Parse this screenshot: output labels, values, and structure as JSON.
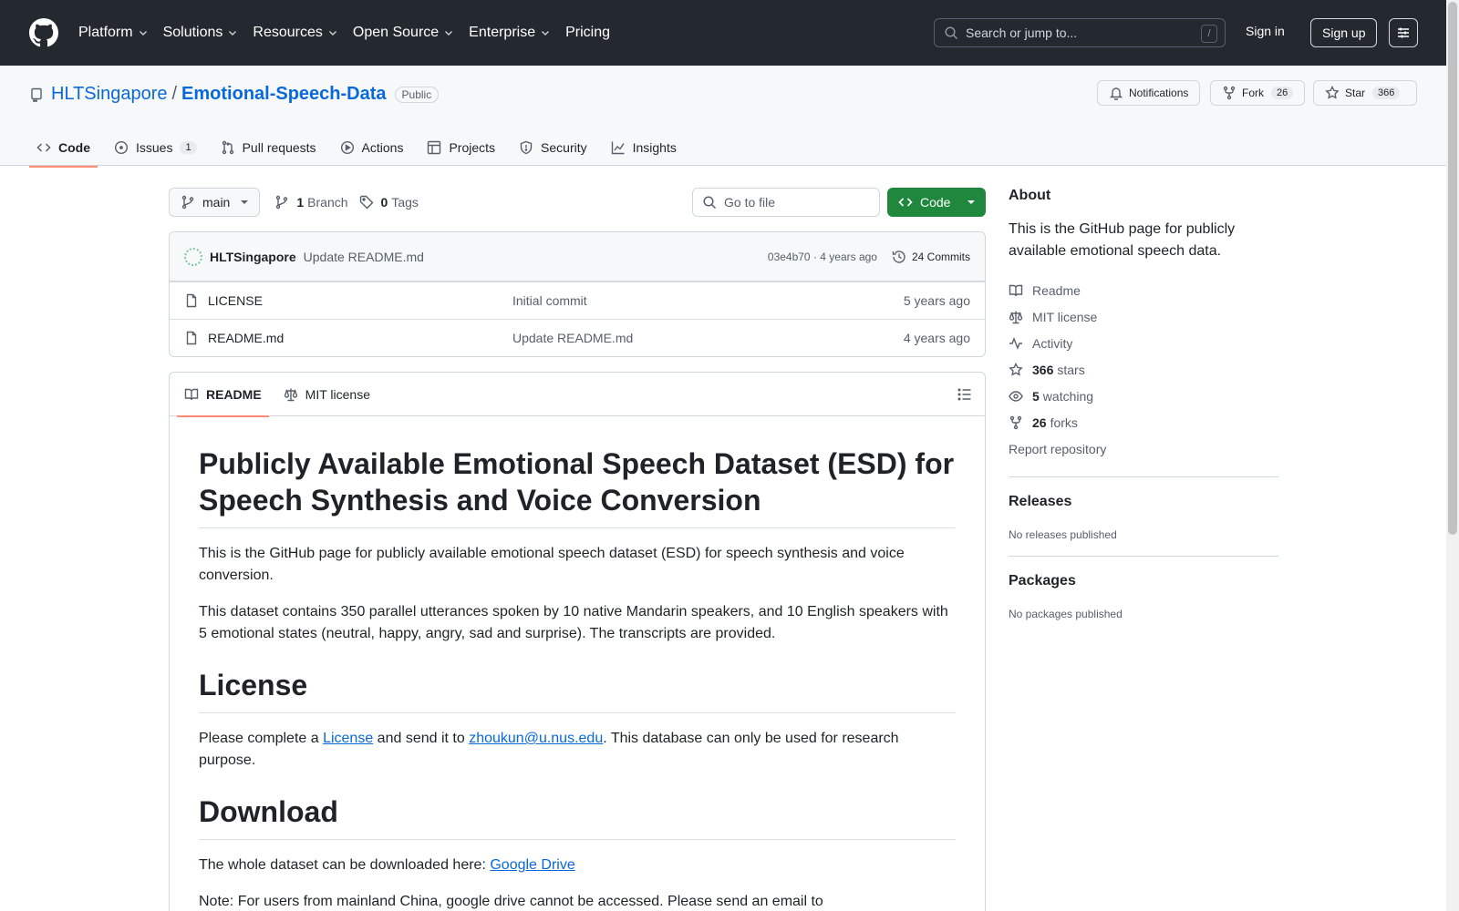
{
  "header": {
    "nav": [
      "Platform",
      "Solutions",
      "Resources",
      "Open Source",
      "Enterprise",
      "Pricing"
    ],
    "search_placeholder": "Search or jump to...",
    "search_key": "/",
    "signin": "Sign in",
    "signup": "Sign up"
  },
  "repo": {
    "owner": "HLTSingapore",
    "separator": "/",
    "name": "Emotional-Speech-Data",
    "visibility": "Public",
    "notifications": "Notifications",
    "fork_label": "Fork",
    "fork_count": "26",
    "star_label": "Star",
    "star_count": "366"
  },
  "tabs": {
    "code": "Code",
    "issues": "Issues",
    "issues_count": "1",
    "pulls": "Pull requests",
    "actions": "Actions",
    "projects": "Projects",
    "security": "Security",
    "insights": "Insights"
  },
  "filenav": {
    "branch": "main",
    "branch_count": "1",
    "branch_label": "Branch",
    "tag_count": "0",
    "tag_label": "Tags",
    "goto_placeholder": "Go to file",
    "code_button": "Code"
  },
  "commit": {
    "author": "HLTSingapore",
    "message": "Update README.md",
    "meta": "03e4b70 · 4 years ago",
    "commits": "24 Commits"
  },
  "files": [
    {
      "name": "LICENSE",
      "message": "Initial commit",
      "date": "5 years ago"
    },
    {
      "name": "README.md",
      "message": "Update README.md",
      "date": "4 years ago"
    }
  ],
  "readme": {
    "tab_readme": "README",
    "tab_license": "MIT license",
    "title": "Publicly Available Emotional Speech Dataset (ESD) for Speech Synthesis and Voice Conversion",
    "p1": "This is the GitHub page for publicly available emotional speech dataset (ESD) for speech synthesis and voice conversion.",
    "p2": "This dataset contains 350 parallel utterances spoken by 10 native Mandarin speakers, and 10 English speakers with 5 emotional states (neutral, happy, angry, sad and surprise). The transcripts are provided.",
    "h_license": "License",
    "license_pre": "Please complete a ",
    "license_link": "License",
    "license_mid": " and send it to ",
    "license_email": "zhoukun@u.nus.edu",
    "license_post": ". This database can only be used for research purpose.",
    "h_download": "Download",
    "download_pre": "The whole dataset can be downloaded here: ",
    "download_link": "Google Drive",
    "note": "Note: For users from mainland China, google drive cannot be accessed. Please send an email to"
  },
  "about": {
    "heading": "About",
    "description": "This is the GitHub page for publicly available emotional speech data.",
    "readme": "Readme",
    "license": "MIT license",
    "activity": "Activity",
    "stars_count": "366",
    "stars_label": "stars",
    "watching_count": "5",
    "watching_label": "watching",
    "forks_count": "26",
    "forks_label": "forks",
    "report": "Report repository"
  },
  "releases": {
    "heading": "Releases",
    "empty": "No releases published"
  },
  "packages": {
    "heading": "Packages",
    "empty": "No packages published"
  },
  "colors": {
    "accent": "#0969da",
    "primary_button": "#1f883d",
    "header_bg": "#24292f",
    "tab_underline": "#fd8c73"
  }
}
